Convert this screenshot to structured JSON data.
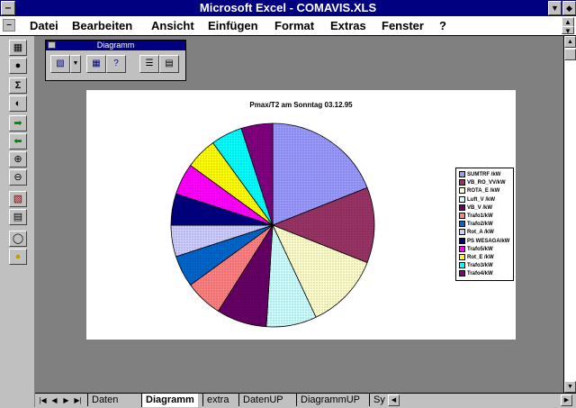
{
  "window": {
    "title": "Microsoft Excel - COMAVIS.XLS"
  },
  "menu": {
    "items": [
      {
        "label": "Datei"
      },
      {
        "label": "Bearbeiten"
      },
      {
        "label": "Ansicht"
      },
      {
        "label": "Einfügen"
      },
      {
        "label": "Format"
      },
      {
        "label": "Extras"
      },
      {
        "label": "Fenster"
      },
      {
        "label": "?"
      }
    ]
  },
  "toolbar_left": {
    "icons": [
      "chartwizard-icon",
      "paint-icon",
      "autosum-icon",
      "function-icon",
      "arrow-right-icon",
      "arrow-left-icon",
      "zoom-in-icon",
      "zoom-out-icon",
      "chart-icon",
      "copy-icon",
      "clock-icon",
      "tip-icon"
    ]
  },
  "chart_toolbar": {
    "title": "Diagramm",
    "icons": [
      "chart-type-icon",
      "dropdown-icon",
      "default-chart-icon",
      "chartwizard-icon",
      "gridlines-icon",
      "legend-icon"
    ]
  },
  "chart_data": {
    "type": "pie",
    "title": "Pmax/T2 am Sonntag 03.12.95",
    "slices": [
      {
        "label": "SUMTRF /kW",
        "value": 19,
        "color": "#9999ff"
      },
      {
        "label": "VB_RO_VV/kW",
        "value": 12,
        "color": "#993366"
      },
      {
        "label": "ROTA_E /kW",
        "value": 12,
        "color": "#ffffcc"
      },
      {
        "label": "Luft_V /kW",
        "value": 8,
        "color": "#ccffff"
      },
      {
        "label": "VB_V /kW",
        "value": 8,
        "color": "#660066"
      },
      {
        "label": "Trafo1/kW",
        "value": 6,
        "color": "#ff8080"
      },
      {
        "label": "Trafo2/kW",
        "value": 5,
        "color": "#0066cc"
      },
      {
        "label": "Rot_A /kW",
        "value": 5,
        "color": "#ccccff"
      },
      {
        "label": "PS WESAGA/kW",
        "value": 5,
        "color": "#000080"
      },
      {
        "label": "Trafo5/kW",
        "value": 5,
        "color": "#ff00ff"
      },
      {
        "label": "Rot_E /kW",
        "value": 5,
        "color": "#ffff00"
      },
      {
        "label": "Trafo3/kW",
        "value": 5,
        "color": "#00ffff"
      },
      {
        "label": "Trafo4/kW",
        "value": 5,
        "color": "#800080"
      }
    ],
    "legend": "right"
  },
  "sheet_tabs": [
    {
      "label": "Daten",
      "active": false
    },
    {
      "label": "Diagramm",
      "active": true
    },
    {
      "label": "extra",
      "active": false
    },
    {
      "label": "DatenUP",
      "active": false
    },
    {
      "label": "DiagrammUP",
      "active": false
    },
    {
      "label": "Sy",
      "active": false
    }
  ]
}
